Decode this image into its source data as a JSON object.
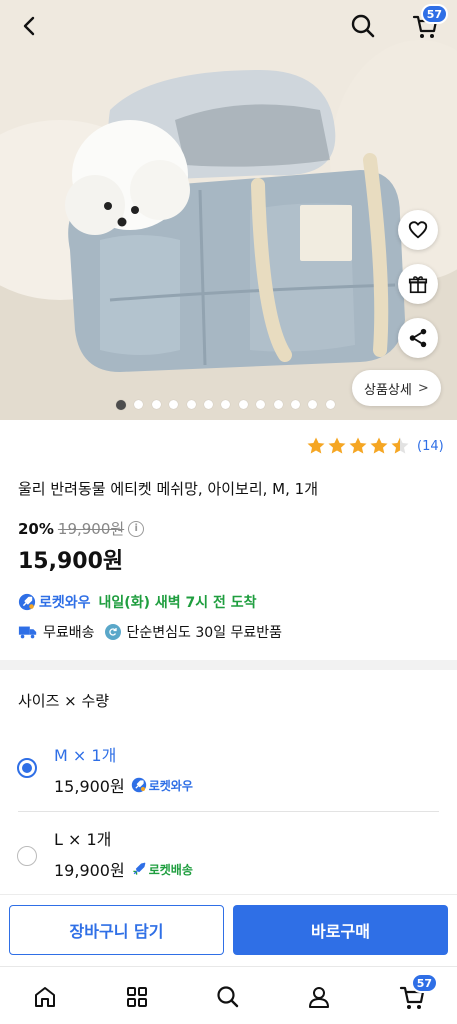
{
  "header": {
    "cart_badge": "57",
    "icons": [
      "back-arrow-icon",
      "search-icon",
      "cart-icon"
    ]
  },
  "hero": {
    "detail_button": "상품상세",
    "detail_chevron": ">",
    "carousel": {
      "total": 13,
      "active": 1
    },
    "side_icons": [
      "heart-icon",
      "gift-icon",
      "share-icon"
    ]
  },
  "product": {
    "rating": {
      "value": 4.5,
      "max": 5,
      "review_count": "(14)"
    },
    "title": "울리 반려동물 에티켓 메쉬망, 아이보리, M, 1개",
    "discount": "20%",
    "original_price": "19,900원",
    "info_icon": "i",
    "price": "15,900원",
    "delivery": {
      "rocket_label": "로켓와우",
      "arrival": "내일(화) 새벽 7시 전 도착"
    },
    "shipping": {
      "free_shipping": "무료배송",
      "free_return": "단순변심도 30일 무료반품"
    }
  },
  "options": {
    "header": "사이즈 × 수량",
    "items": [
      {
        "name": "M × 1개",
        "price": "15,900원",
        "tag": "로켓와우",
        "selected": true
      },
      {
        "name": "L × 1개",
        "price": "19,900원",
        "tag": "로켓배송",
        "selected": false
      }
    ]
  },
  "actions": {
    "add_to_cart": "장바구니 담기",
    "buy_now": "바로구매"
  },
  "bottom_nav": {
    "icons": [
      "home-icon",
      "category-icon",
      "search-icon",
      "my-page-icon",
      "cart-icon"
    ],
    "cart_badge": "57"
  },
  "colors": {
    "accent": "#2f6fe6",
    "arrival_green": "#1f9e3f",
    "star": "#f5a623"
  }
}
